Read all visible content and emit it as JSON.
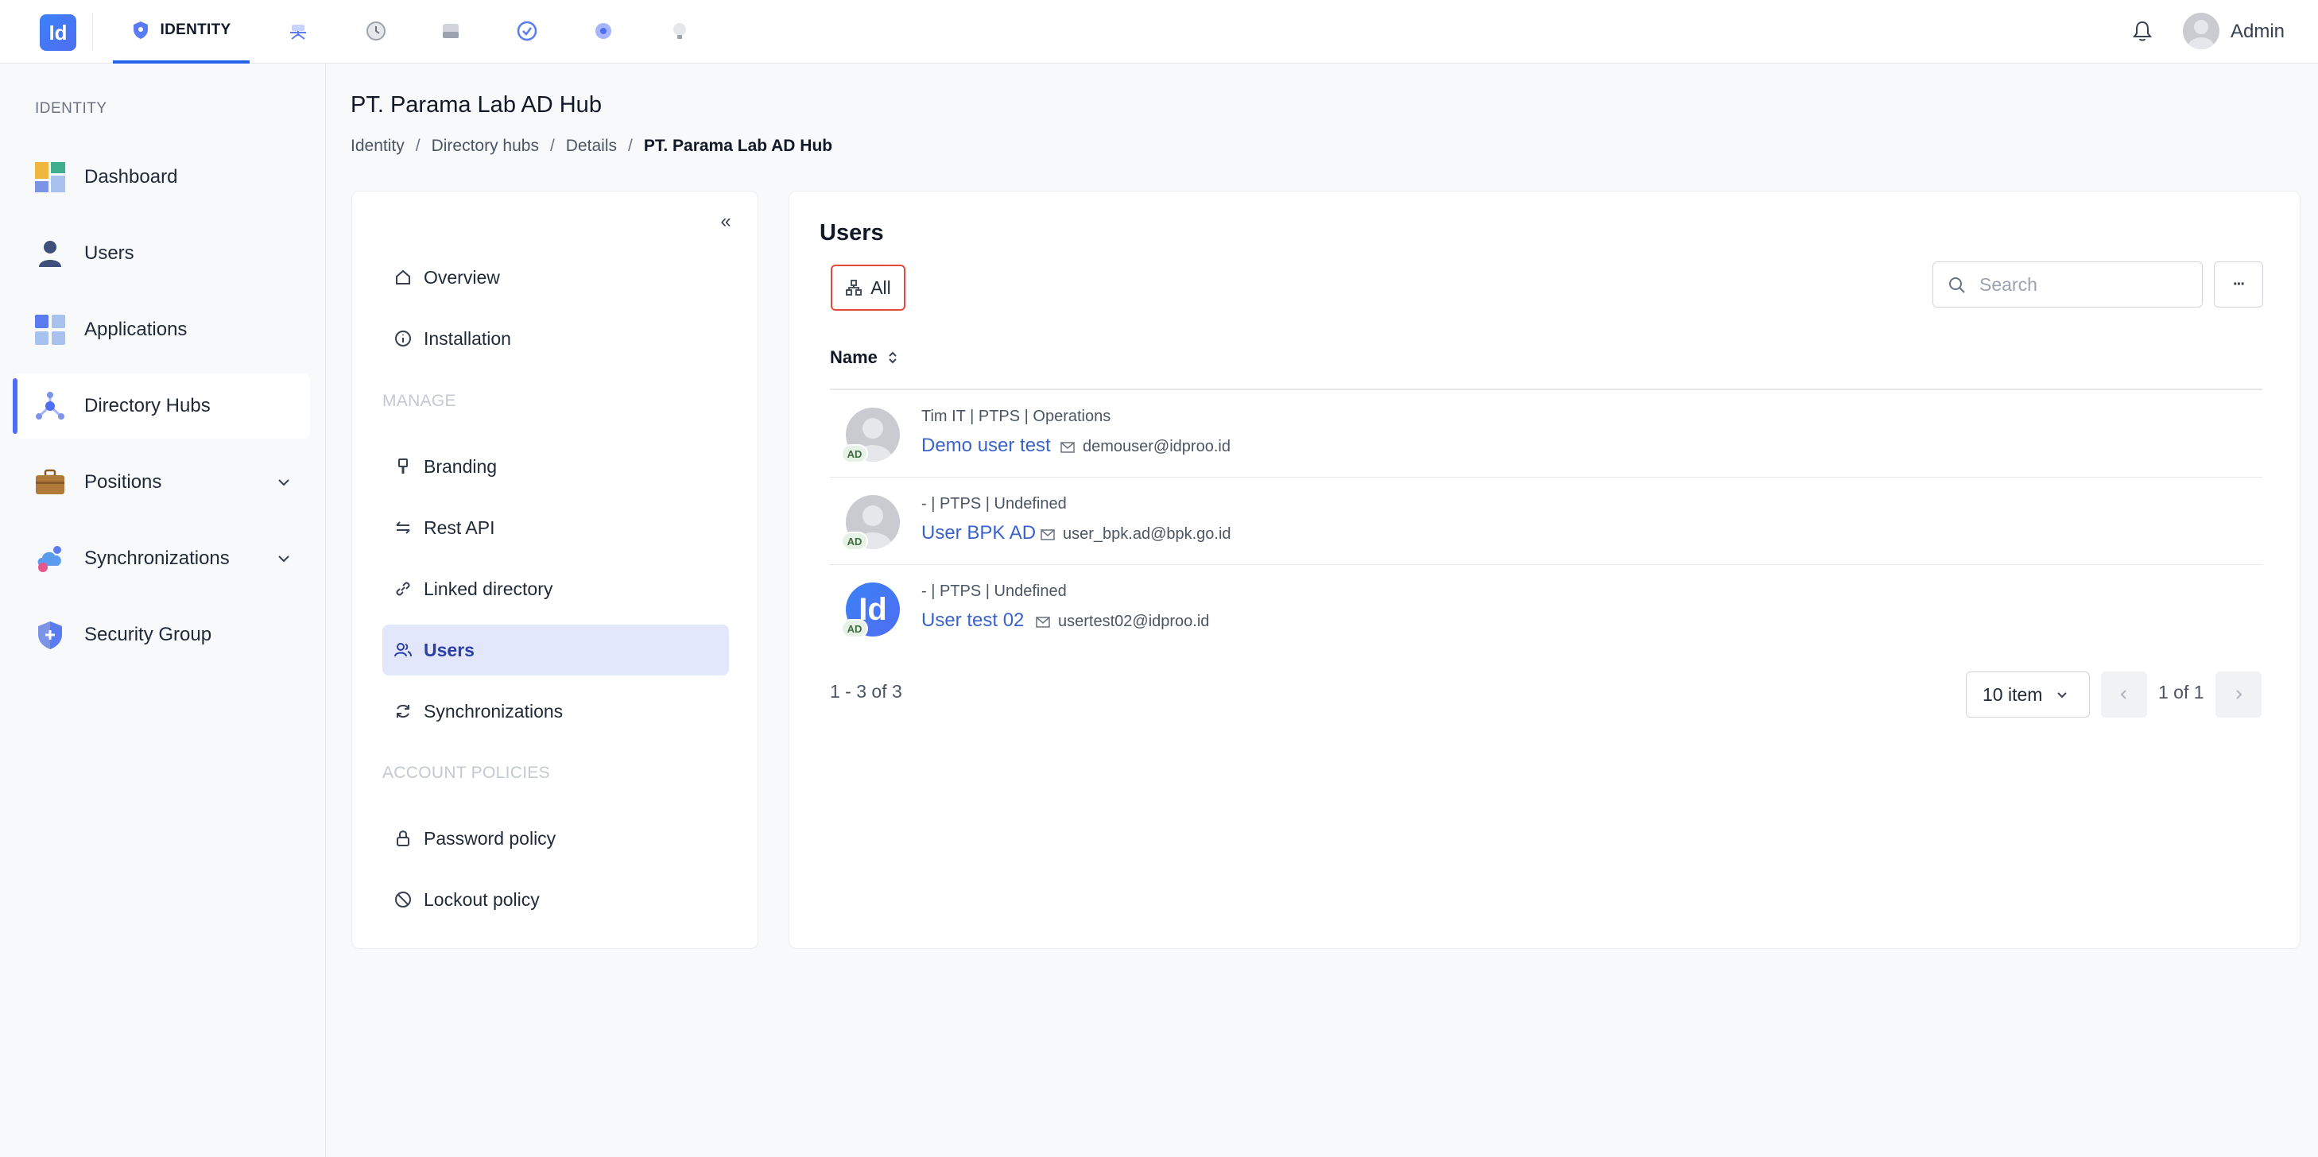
{
  "app": {
    "logo_text": "Id",
    "active_module": "IDENTITY",
    "module_icons": [
      "shield-icon",
      "network-icon",
      "clock-icon",
      "storage-icon",
      "check-circle-icon",
      "gear-icon",
      "bulb-icon"
    ],
    "user_name": "Admin",
    "accent_color": "#4f6df2"
  },
  "sidebar": {
    "section": "IDENTITY",
    "items": [
      {
        "label": "Dashboard",
        "icon": "dashboard-icon"
      },
      {
        "label": "Users",
        "icon": "user-icon"
      },
      {
        "label": "Applications",
        "icon": "apps-grid-icon"
      },
      {
        "label": "Directory Hubs",
        "icon": "directory-hub-icon",
        "active": true
      },
      {
        "label": "Positions",
        "icon": "briefcase-icon",
        "expandable": true
      },
      {
        "label": "Synchronizations",
        "icon": "cloud-sync-icon",
        "expandable": true
      },
      {
        "label": "Security Group",
        "icon": "shield-plus-icon"
      }
    ]
  },
  "page": {
    "title": "PT. Parama Lab AD Hub",
    "breadcrumb": [
      "Identity",
      "Directory hubs",
      "Details",
      "PT. Parama Lab AD Hub"
    ],
    "breadcrumb_sep": "/"
  },
  "detail_nav": {
    "collapse_symbol": "«",
    "items_top": [
      {
        "label": "Overview",
        "icon": "home-icon"
      },
      {
        "label": "Installation",
        "icon": "info-icon"
      }
    ],
    "manage_section": "MANAGE",
    "items_manage": [
      {
        "label": "Branding",
        "icon": "brush-icon"
      },
      {
        "label": "Rest API",
        "icon": "arrows-icon"
      },
      {
        "label": "Linked directory",
        "icon": "link-icon"
      },
      {
        "label": "Users",
        "icon": "users-icon",
        "active": true
      },
      {
        "label": "Synchronizations",
        "icon": "refresh-icon"
      }
    ],
    "policies_section": "ACCOUNT POLICIES",
    "items_policies": [
      {
        "label": "Password policy",
        "icon": "lock-icon"
      },
      {
        "label": "Lockout policy",
        "icon": "ban-icon"
      }
    ]
  },
  "users_panel": {
    "title": "Users",
    "filter_label": "All",
    "search_placeholder": "Search",
    "more_symbol": "···",
    "column_name": "Name",
    "rows": [
      {
        "meta": "Tim IT | PTPS | Operations",
        "name": "Demo user test",
        "email": "demouser@idproo.id",
        "badge": "AD",
        "avatar": "default-avatar"
      },
      {
        "meta": "- | PTPS | Undefined",
        "name": "User BPK AD",
        "email": "user_bpk.ad@bpk.go.id",
        "badge": "AD",
        "avatar": "default-avatar"
      },
      {
        "meta": "- | PTPS | Undefined",
        "name": "User test 02",
        "email": "usertest02@idproo.id",
        "badge": "AD",
        "avatar": "brand-avatar",
        "avatar_text": "Id"
      }
    ],
    "range_text": "1 - 3 of 3",
    "page_size": "10 item",
    "page_text": "1 of 1"
  }
}
